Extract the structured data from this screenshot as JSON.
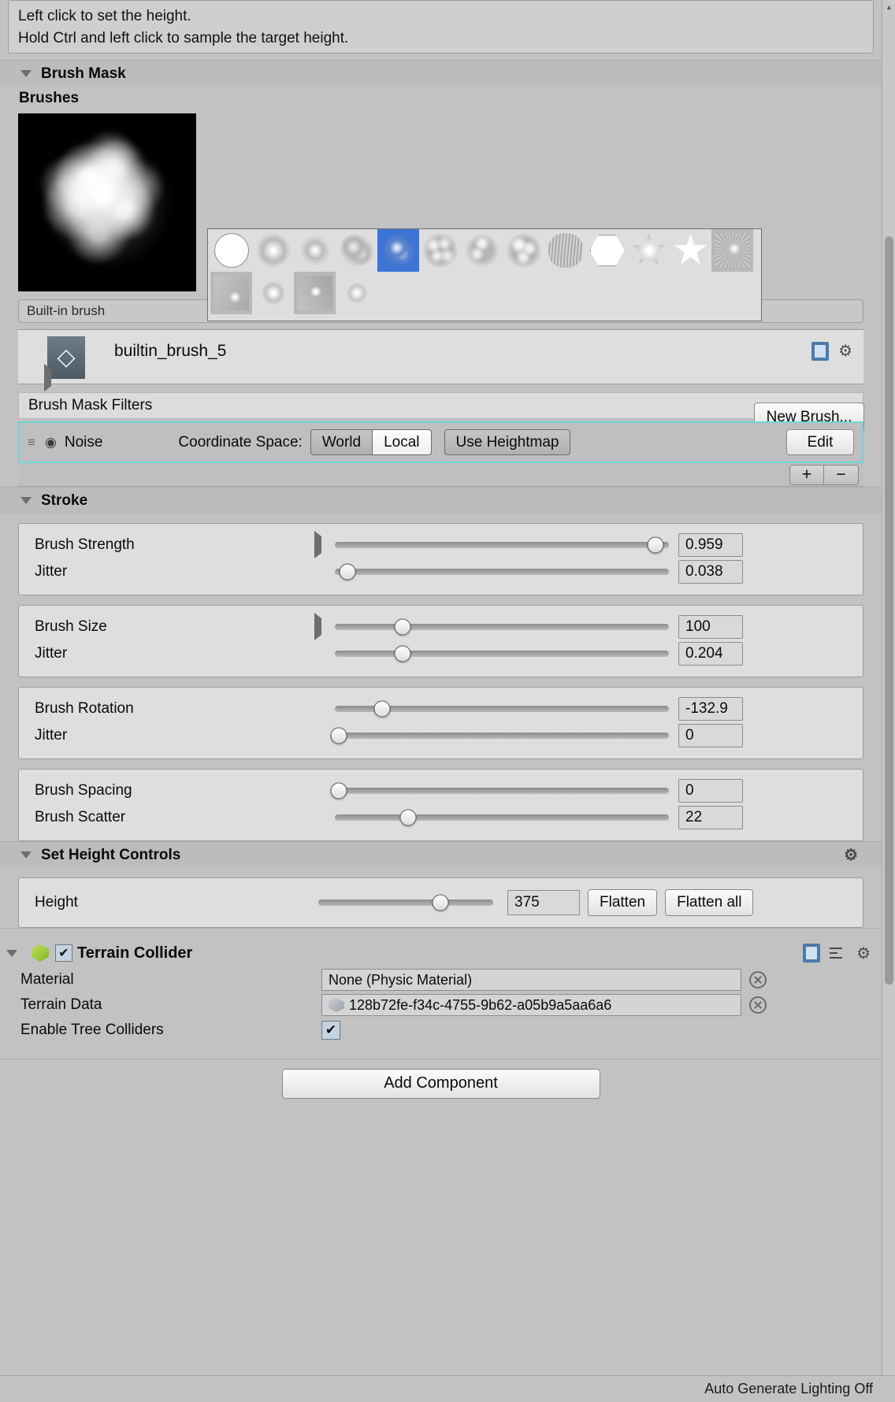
{
  "help": {
    "line1": "Left click to set the height.",
    "line2": "Hold Ctrl and left click to sample the target height."
  },
  "brush_mask": {
    "header": "Brush Mask",
    "brushes_label": "Brushes",
    "new_brush_label": "New Brush...",
    "builtin_field": "Built-in brush",
    "asset_name": "builtin_brush_5",
    "filters_header": "Brush Mask Filters",
    "selected_index": 4,
    "plus_label": "+",
    "minus_label": "−"
  },
  "noise_filter": {
    "name": "Noise",
    "coord_space_label": "Coordinate Space:",
    "world_label": "World",
    "local_label": "Local",
    "active_space": "Local",
    "use_heightmap_label": "Use Heightmap",
    "edit_label": "Edit"
  },
  "stroke": {
    "header": "Stroke",
    "groups": [
      {
        "rows": [
          {
            "label": "Brush Strength",
            "value": "0.959",
            "pct": 95.9,
            "expandable": true
          },
          {
            "label": "Jitter",
            "value": "0.038",
            "pct": 3.8,
            "expandable": false
          }
        ]
      },
      {
        "rows": [
          {
            "label": "Brush Size",
            "value": "100",
            "pct": 20.4,
            "expandable": true
          },
          {
            "label": "Jitter",
            "value": "0.204",
            "pct": 20.4,
            "expandable": false
          }
        ]
      },
      {
        "rows": [
          {
            "label": "Brush Rotation",
            "value": "-132.9",
            "pct": 14.2,
            "expandable": false
          },
          {
            "label": "Jitter",
            "value": "0",
            "pct": 1.2,
            "expandable": false
          }
        ]
      },
      {
        "rows": [
          {
            "label": "Brush Spacing",
            "value": "0",
            "pct": 1.2,
            "expandable": false
          },
          {
            "label": "Brush Scatter",
            "value": "22",
            "pct": 22.0,
            "expandable": false
          }
        ]
      }
    ]
  },
  "set_height": {
    "header": "Set Height Controls",
    "height_label": "Height",
    "height_value": "375",
    "height_pct": 70,
    "flatten_label": "Flatten",
    "flatten_all_label": "Flatten all"
  },
  "terrain_collider": {
    "title": "Terrain Collider",
    "enabled": true,
    "material_label": "Material",
    "material_value": "None (Physic Material)",
    "terrain_data_label": "Terrain Data",
    "terrain_data_value": "128b72fe-f34c-4755-9b62-a05b9a5aa6a6",
    "tree_colliders_label": "Enable Tree Colliders",
    "tree_colliders_checked": true
  },
  "footer": {
    "add_component_label": "Add Component",
    "status": "Auto Generate Lighting Off"
  },
  "colors": {
    "selection_blue": "#3d75d6",
    "highlight_cyan": "#6fd5d5",
    "panel_bg": "#c2c2c2"
  },
  "icons": {
    "gear": "⚙",
    "eye": "◉",
    "drag": "≡",
    "check": "✔",
    "unity": "◇"
  }
}
